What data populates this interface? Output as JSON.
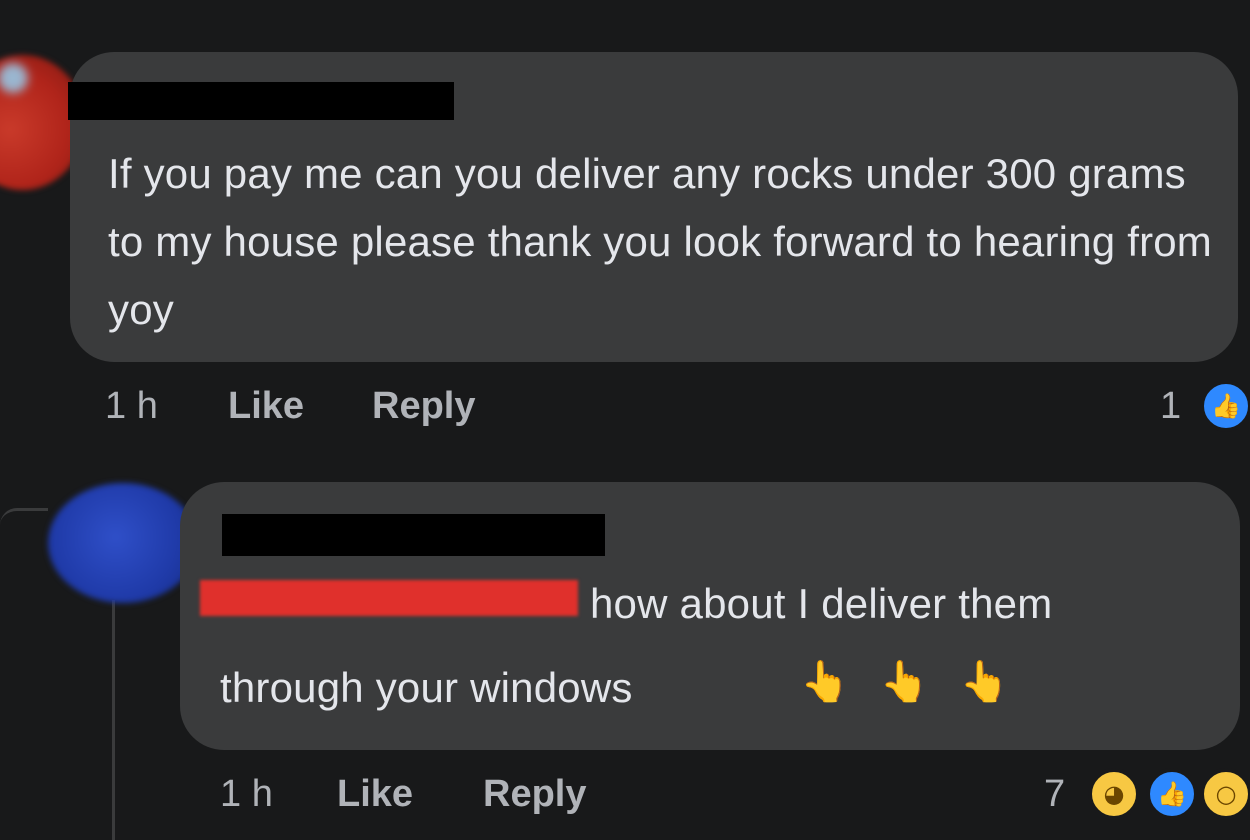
{
  "comments": [
    {
      "author_redacted": true,
      "text": "If you pay me can you deliver any rocks under 300 grams to my house please thank you look forward to hearing from yoy",
      "time": "1 h",
      "like_label": "Like",
      "reply_label": "Reply",
      "reaction_count": "1",
      "reactions": [
        "like-icon"
      ]
    },
    {
      "author_redacted": true,
      "mention_redacted": true,
      "text_line1": "how about I deliver them",
      "text_line2": "through your windows",
      "emojis": [
        "👆",
        "👆",
        "👆"
      ],
      "time": "1 h",
      "like_label": "Like",
      "reply_label": "Reply",
      "reaction_count": "7",
      "reactions": [
        "haha-icon",
        "like-icon",
        "wow-icon"
      ]
    }
  ],
  "colors": {
    "background": "#18191a",
    "bubble": "#3a3b3c",
    "text": "#e4e6eb",
    "secondary_text": "#b0b3b8",
    "like_blue": "#2e89ff",
    "emoji_yellow": "#f7c843"
  }
}
